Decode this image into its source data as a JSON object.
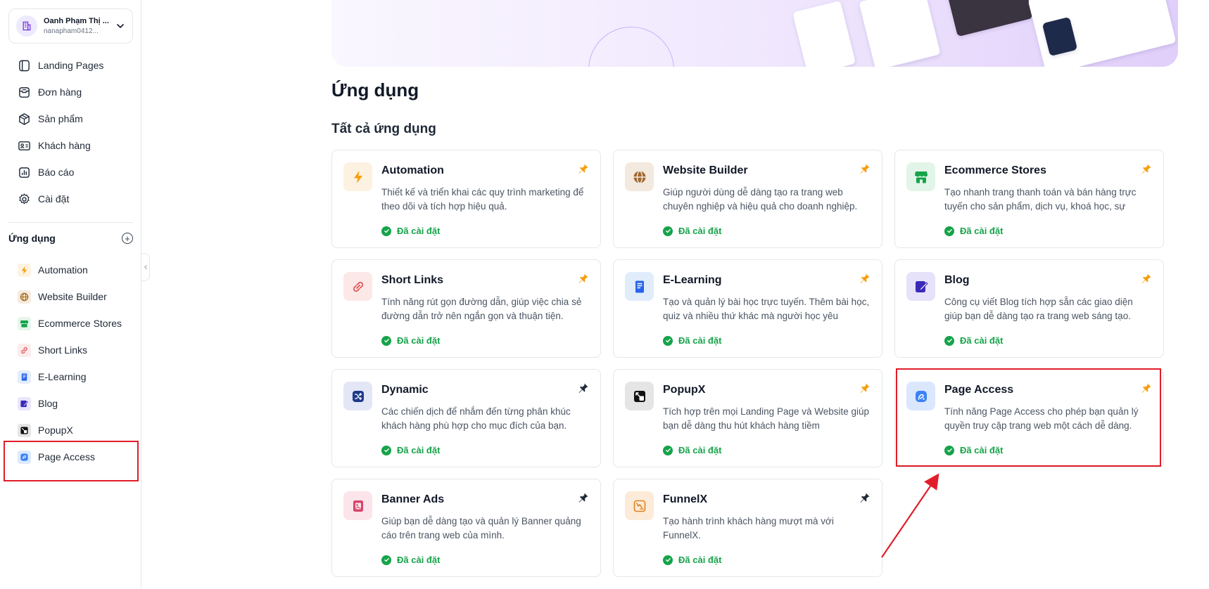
{
  "account": {
    "name": "Oanh Phạm Thị ...",
    "email": "nanapham0412..."
  },
  "nav": [
    {
      "label": "Landing Pages",
      "icon": "landing-pages-icon"
    },
    {
      "label": "Đơn hàng",
      "icon": "orders-icon"
    },
    {
      "label": "Sản phẩm",
      "icon": "box-icon"
    },
    {
      "label": "Khách hàng",
      "icon": "contact-card-icon"
    },
    {
      "label": "Báo cáo",
      "icon": "report-icon"
    },
    {
      "label": "Cài đặt",
      "icon": "gear-icon"
    }
  ],
  "apps_section": {
    "title": "Ứng dụng",
    "add_label": "+"
  },
  "app_nav": [
    {
      "label": "Automation"
    },
    {
      "label": "Website Builder"
    },
    {
      "label": "Ecommerce Stores"
    },
    {
      "label": "Short Links"
    },
    {
      "label": "E-Learning"
    },
    {
      "label": "Blog"
    },
    {
      "label": "PopupX"
    },
    {
      "label": "Page Access"
    }
  ],
  "page": {
    "title": "Ứng dụng",
    "section_title": "Tất cả ứng dụng"
  },
  "cards": [
    {
      "title": "Automation",
      "desc": "Thiết kế và triển khai các quy trình marketing để theo dõi và tích hợp hiệu quả.",
      "status": "Đã cài đặt",
      "pinned": true
    },
    {
      "title": "Website Builder",
      "desc": "Giúp người dùng dễ dàng tạo ra trang web chuyên nghiệp và hiệu quả cho doanh nghiệp.",
      "status": "Đã cài đặt",
      "pinned": true
    },
    {
      "title": "Ecommerce Stores",
      "desc": "Tạo nhanh trang thanh toán và bán hàng trực tuyến cho sản phẩm, dịch vụ, khoá học, sự",
      "status": "Đã cài đặt",
      "pinned": true
    },
    {
      "title": "Short Links",
      "desc": "Tính năng rút gọn đường dẫn, giúp việc chia sẻ đường dẫn trở nên ngắn gọn và thuận tiện.",
      "status": "Đã cài đặt",
      "pinned": true
    },
    {
      "title": "E-Learning",
      "desc": "Tạo và quản lý bài học trực tuyến. Thêm bài học, quiz và nhiều thứ khác mà người học yêu",
      "status": "Đã cài đặt",
      "pinned": true
    },
    {
      "title": "Blog",
      "desc": "Công cụ viết Blog tích hợp sẵn các giao diện giúp bạn dễ dàng tạo ra trang web sáng tạo.",
      "status": "Đã cài đặt",
      "pinned": true
    },
    {
      "title": "Dynamic",
      "desc": "Các chiến dịch để nhắm đến từng phân khúc khách hàng phù hợp cho mục đích của bạn.",
      "status": "Đã cài đặt",
      "pinned": false
    },
    {
      "title": "PopupX",
      "desc": "Tích hợp trên mọi Landing Page và Website giúp bạn dễ dàng thu hút khách hàng tiềm",
      "status": "Đã cài đặt",
      "pinned": true
    },
    {
      "title": "Page Access",
      "desc": "Tính năng Page Access cho phép bạn quản lý quyền truy cập trang web một cách dễ dàng.",
      "status": "Đã cài đặt",
      "pinned": true
    },
    {
      "title": "Banner Ads",
      "desc": "Giúp bạn dễ dàng tạo và quản lý Banner quảng cáo trên trang web của mình.",
      "status": "Đã cài đặt",
      "pinned": false
    },
    {
      "title": "FunnelX",
      "desc": "Tạo hành trình khách hàng mượt mà với FunnelX.",
      "status": "Đã cài đặt",
      "pinned": false
    }
  ],
  "colors": {
    "accent_orange": "#f59e0b",
    "success": "#16a34a",
    "highlight": "#e11d2a",
    "pin_active": "#f59e0b",
    "pin_inactive": "#1f2937"
  }
}
